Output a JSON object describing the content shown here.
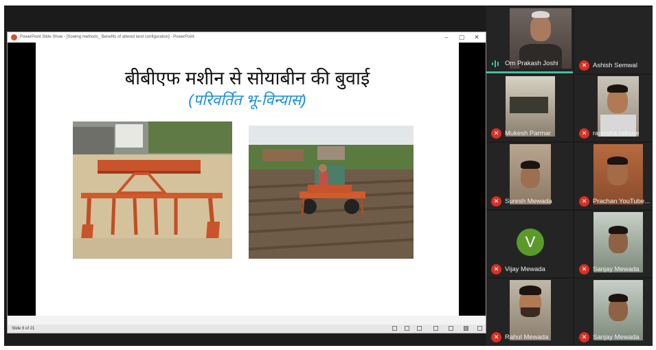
{
  "ppt_window": {
    "title": "PowerPoint Slide Show - [Sowing methods_ Benefits of altered land configuration] - PowerPoint",
    "minimize": "–",
    "restore": "▢",
    "close": "✕",
    "status_slide": "Slide 8 of 21"
  },
  "slide": {
    "title": "बीबीएफ मशीन से सोयाबीन की बुवाई",
    "subtitle": "(परिवर्तित भू-विन्यास)"
  },
  "participants": [
    {
      "name": "Om Prakash Joshi",
      "muted": false,
      "speaking": true
    },
    {
      "name": "Ashish Semwal",
      "muted": true
    },
    {
      "name": "Mukesh Parmar",
      "muted": true
    },
    {
      "name": "rajendra rathore",
      "muted": true
    },
    {
      "name": "Suresh Mewada",
      "muted": true
    },
    {
      "name": "Prachan YouTube...",
      "muted": true
    },
    {
      "name": "Vijay Mewada",
      "muted": true,
      "avatar_letter": "V"
    },
    {
      "name": "Sanjay Mewada",
      "muted": true
    },
    {
      "name": "Rahul Mewada",
      "muted": true
    },
    {
      "name": "Sanjay Mewada",
      "muted": true
    }
  ],
  "icons": {
    "mic_muted": "mic-muted-icon",
    "mic_active": "audio-level-icon"
  }
}
